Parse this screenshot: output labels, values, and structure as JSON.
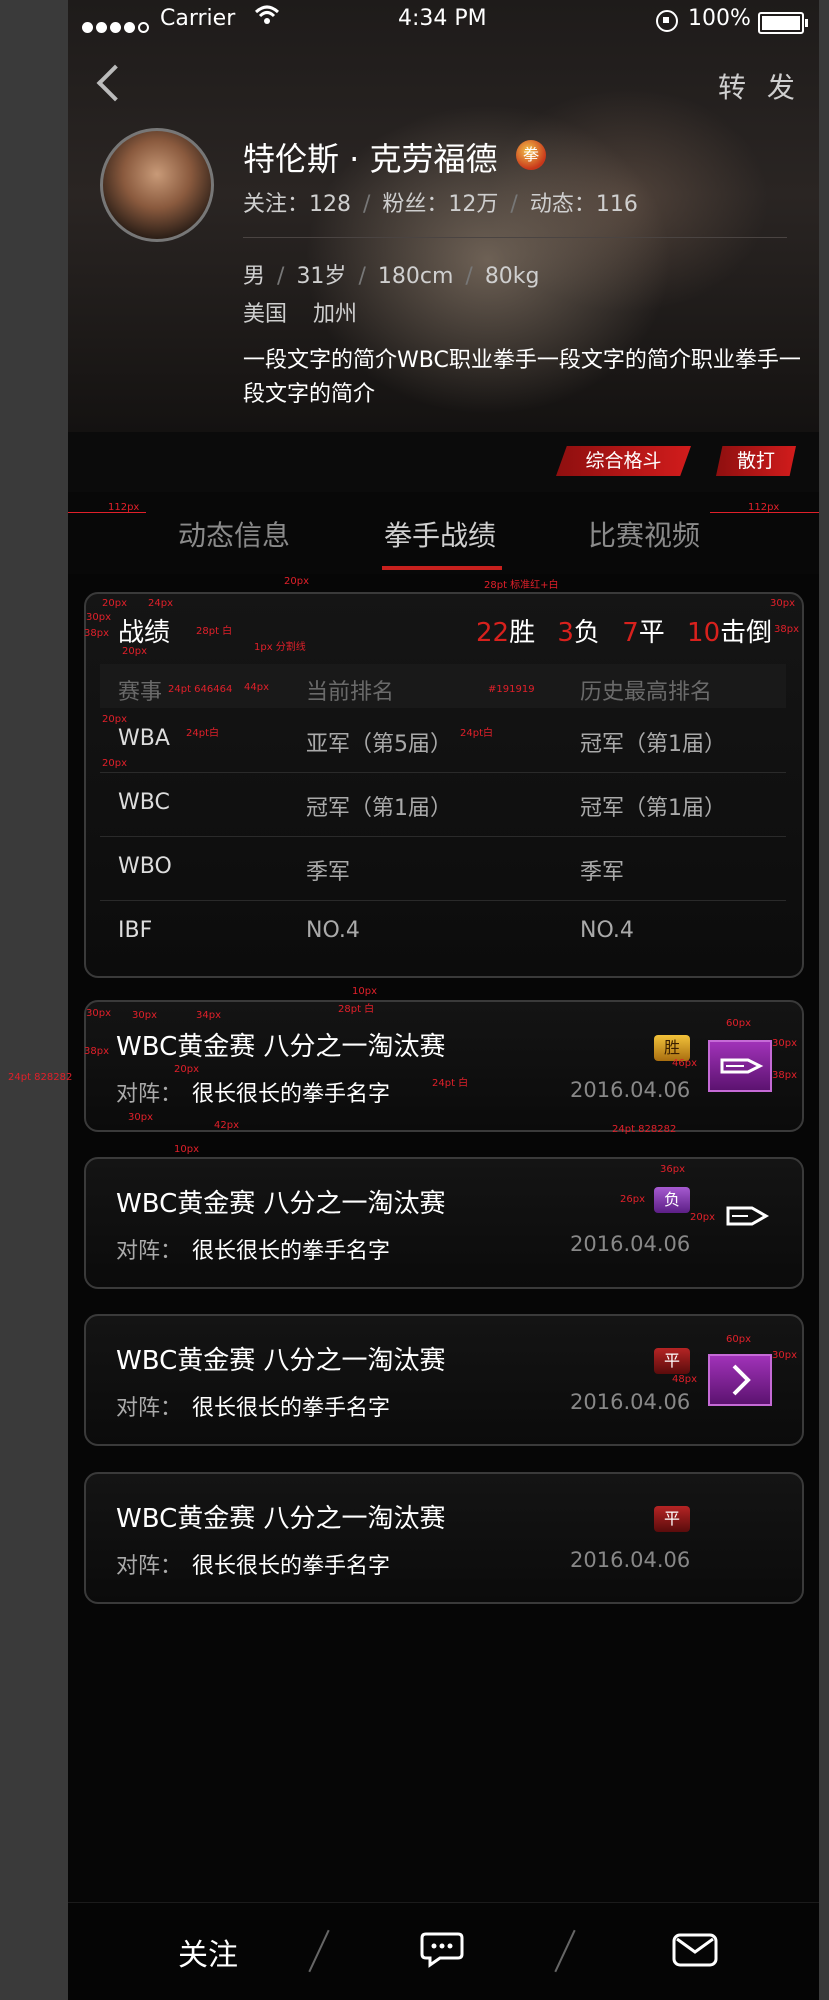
{
  "status_bar": {
    "carrier": "Carrier",
    "time": "4:34 PM",
    "battery": "100%"
  },
  "header": {
    "back_icon": "chevron-left-icon",
    "share_label": "转 发"
  },
  "profile": {
    "name": "特伦斯 · 克劳福德",
    "badge": "拳",
    "stats": {
      "follow": "关注：128",
      "fans": "粉丝：12万",
      "feed": "动态：116"
    },
    "gender": "男",
    "age": "31岁",
    "height": "180cm",
    "weight": "80kg",
    "country": "美国",
    "region": "加州",
    "bio": "一段文字的简介WBC职业拳手一段文字的简介职业拳手一段文字的简介",
    "tags": [
      "综合格斗",
      "散打"
    ]
  },
  "tabs": [
    {
      "label": "动态信息",
      "active": false
    },
    {
      "label": "拳手战绩",
      "active": true
    },
    {
      "label": "比赛视频",
      "active": false
    }
  ],
  "record": {
    "title": "战绩",
    "wins": "22",
    "wins_label": "胜",
    "losses": "3",
    "losses_label": "负",
    "draws": "7",
    "draws_label": "平",
    "ko": "10",
    "ko_label": "击倒",
    "columns": [
      "赛事",
      "当前排名",
      "历史最高排名"
    ],
    "rows": [
      [
        "WBA",
        "亚军（第5届）",
        "冠军（第1届）"
      ],
      [
        "WBC",
        "冠军（第1届）",
        "冠军（第1届）"
      ],
      [
        "WBO",
        "季军",
        "季军"
      ],
      [
        "IBF",
        "NO.4",
        "NO.4"
      ]
    ]
  },
  "matches": [
    {
      "title": "WBC黄金赛 八分之一淘汰赛",
      "opp_label": "对阵：",
      "opponent": "很长很长的拳手名字",
      "date": "2016.04.06",
      "result": "胜"
    },
    {
      "title": "WBC黄金赛 八分之一淘汰赛",
      "opp_label": "对阵：",
      "opponent": "很长很长的拳手名字",
      "date": "2016.04.06",
      "result": "负"
    },
    {
      "title": "WBC黄金赛 八分之一淘汰赛",
      "opp_label": "对阵：",
      "opponent": "很长很长的拳手名字",
      "date": "2016.04.06",
      "result": "平"
    },
    {
      "title": "WBC黄金赛 八分之一淘汰赛",
      "opp_label": "对阵：",
      "opponent": "很长很长的拳手名字",
      "date": "2016.04.06",
      "result": "平"
    }
  ],
  "bottom_bar": {
    "follow_label": "关注",
    "chat_icon": "chat-bubble-icon",
    "mail_icon": "mail-icon"
  },
  "annotations": {
    "px112": "112px",
    "px20": "20px",
    "px24": "24px",
    "px30": "30px",
    "px36": "36px",
    "px38": "38px",
    "px34": "34px",
    "px42": "42px",
    "px44": "44px",
    "px46": "46px",
    "px48": "48px",
    "px60": "60px",
    "px10": "10px",
    "px26": "26px",
    "pt28_white": "28pt 白",
    "pt28_red": "28pt 标准红+白",
    "divider": "1px 分割线",
    "pt24_gray": "24pt 646464",
    "pt24_white": "24pt白",
    "bg": "#191919",
    "pt24_828282": "24pt 828282",
    "pt24_white2": "24pt 白"
  },
  "colors": {
    "accent_red": "#d8211d",
    "bg": "#060606",
    "purple": "#8a2aa6"
  }
}
